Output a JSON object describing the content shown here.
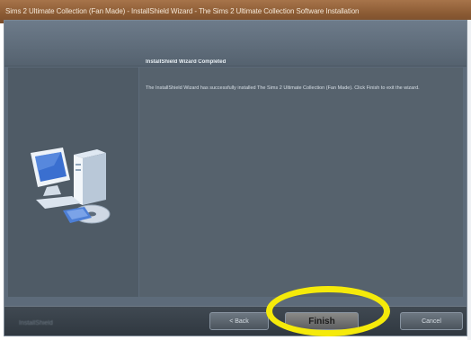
{
  "window": {
    "title": "Sims 2 Ultimate Collection (Fan Made) - InstallShield Wizard - The Sims 2 Ultimate Collection Software Installation"
  },
  "wizard": {
    "heading": "InstallShield Wizard Completed",
    "body": "The InstallShield Wizard has successfully installed The Sims 2 Ultimate Collection (Fan Made). Click Finish to exit the wizard."
  },
  "footer": {
    "brand": "InstallShield",
    "back_label": "< Back",
    "finish_label": "Finish",
    "cancel_label": "Cancel"
  },
  "colors": {
    "highlight": "#f5ea0a",
    "window_bg": "#5d6b7a",
    "titlebar": "#8a5a33"
  },
  "icons": {
    "setup_graphic": "computer-with-disc-icon"
  }
}
